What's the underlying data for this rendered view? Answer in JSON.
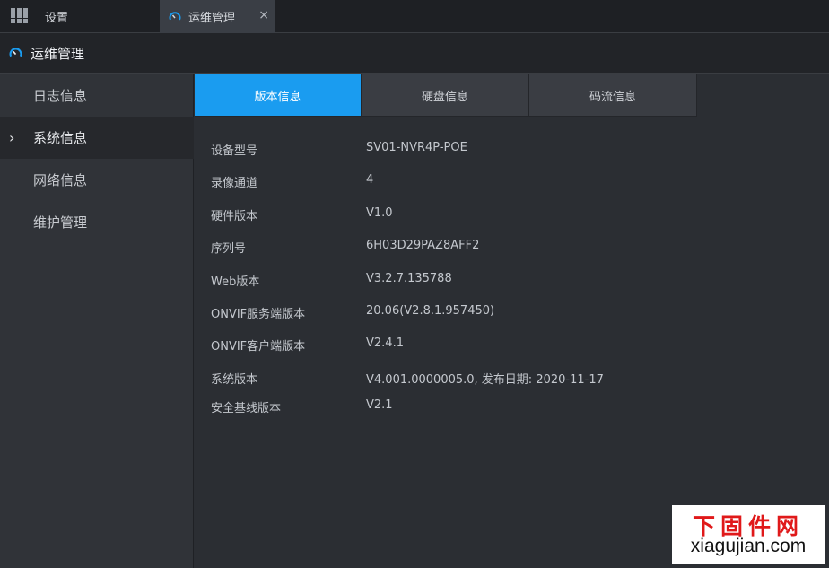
{
  "topbar": {
    "settings_label": "设置",
    "ops_tab_label": "运维管理",
    "close_glyph": "×"
  },
  "title": "运维管理",
  "sidebar": {
    "items": [
      {
        "label": "日志信息"
      },
      {
        "label": "系统信息",
        "selected": true
      },
      {
        "label": "网络信息"
      },
      {
        "label": "维护管理"
      }
    ]
  },
  "subtabs": [
    {
      "label": "版本信息",
      "selected": true
    },
    {
      "label": "硬盘信息"
    },
    {
      "label": "码流信息"
    }
  ],
  "version_info": [
    {
      "label": "设备型号",
      "value": "SV01-NVR4P-POE"
    },
    {
      "label": "录像通道",
      "value": "4"
    },
    {
      "label": "硬件版本",
      "value": "V1.0"
    },
    {
      "label": "序列号",
      "value": "6H03D29PAZ8AFF2"
    },
    {
      "label": "Web版本",
      "value": "V3.2.7.135788"
    },
    {
      "label": "ONVIF服务端版本",
      "value": "20.06(V2.8.1.957450)"
    },
    {
      "label": "ONVIF客户端版本",
      "value": "V2.4.1"
    },
    {
      "label": "系统版本",
      "value": "V4.001.0000005.0, 发布日期: 2020-11-17"
    },
    {
      "label": "安全基线版本",
      "value": "V2.1"
    }
  ],
  "watermark": {
    "cn": "下固件网",
    "en": "xiagujian.com"
  },
  "colors": {
    "accent": "#1a9cf0",
    "background": "#2b2e33",
    "sidebar": "#303338"
  }
}
